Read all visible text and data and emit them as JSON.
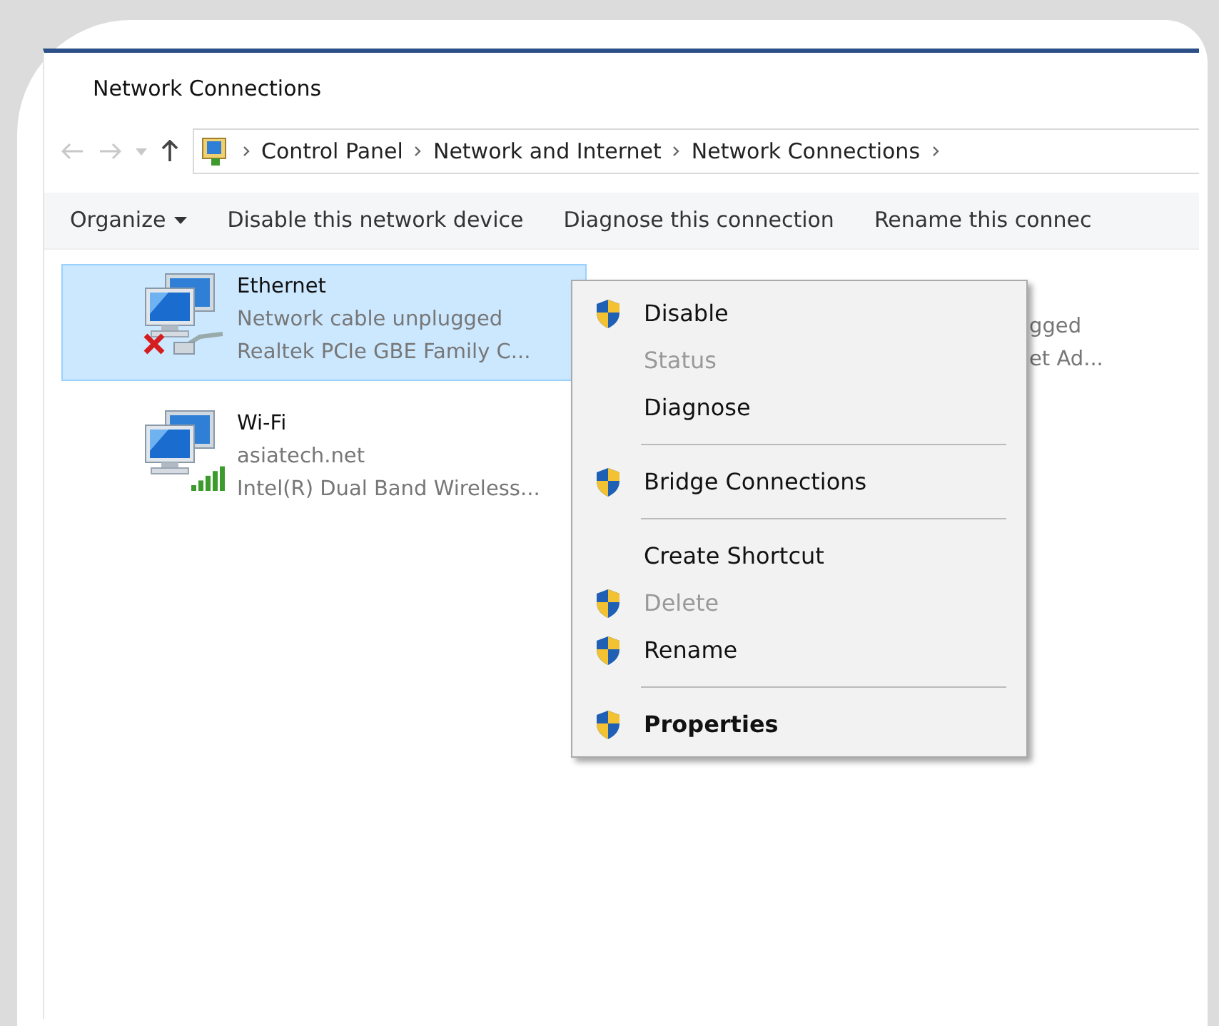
{
  "window": {
    "title": "Network Connections"
  },
  "address_bar": {
    "path": [
      "Control Panel",
      "Network and Internet",
      "Network Connections"
    ]
  },
  "toolbar": {
    "items": [
      {
        "label": "Organize",
        "dropdown": true
      },
      {
        "label": "Disable this network device",
        "dropdown": false
      },
      {
        "label": "Diagnose this connection",
        "dropdown": false
      },
      {
        "label": "Rename this connec",
        "dropdown": false
      }
    ]
  },
  "connections": [
    {
      "kind": "ethernet",
      "name": "Ethernet",
      "status": "Network cable unplugged",
      "device": "Realtek PCIe GBE Family C...",
      "selected": true
    },
    {
      "kind": "wifi",
      "name": "Wi-Fi",
      "status": "asiatech.net",
      "device": "Intel(R) Dual Band Wireless...",
      "selected": false
    }
  ],
  "covered_connection": {
    "status": "gged",
    "device": "et Ad..."
  },
  "context_menu": {
    "items": [
      {
        "kind": "item",
        "label": "Disable",
        "shield": true,
        "disabled": false,
        "default": false
      },
      {
        "kind": "item",
        "label": "Status",
        "shield": false,
        "disabled": true,
        "default": false
      },
      {
        "kind": "item",
        "label": "Diagnose",
        "shield": false,
        "disabled": false,
        "default": false
      },
      {
        "kind": "separator"
      },
      {
        "kind": "item",
        "label": "Bridge Connections",
        "shield": true,
        "disabled": false,
        "default": false
      },
      {
        "kind": "separator"
      },
      {
        "kind": "item",
        "label": "Create Shortcut",
        "shield": false,
        "disabled": false,
        "default": false
      },
      {
        "kind": "item",
        "label": "Delete",
        "shield": true,
        "disabled": true,
        "default": false
      },
      {
        "kind": "item",
        "label": "Rename",
        "shield": true,
        "disabled": false,
        "default": false
      },
      {
        "kind": "separator"
      },
      {
        "kind": "item",
        "label": "Properties",
        "shield": true,
        "disabled": false,
        "default": true
      }
    ]
  }
}
